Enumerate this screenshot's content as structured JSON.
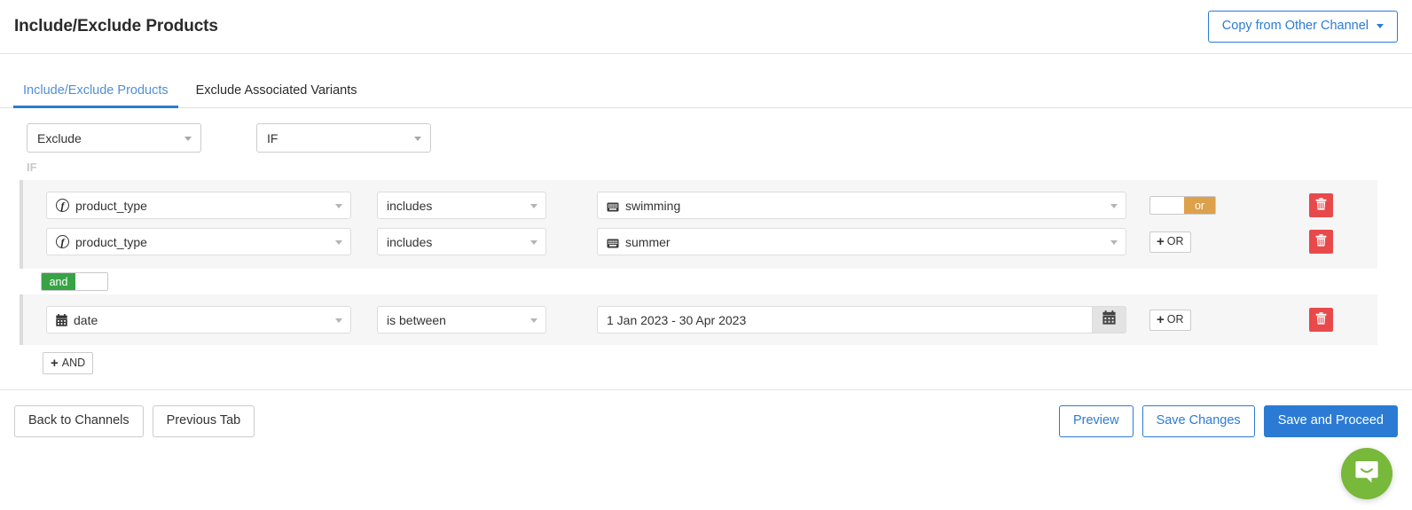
{
  "header": {
    "title": "Include/Exclude Products",
    "copy_button_label": "Copy from Other Channel"
  },
  "tabs": [
    {
      "label": "Include/Exclude Products",
      "active": true
    },
    {
      "label": "Exclude Associated Variants",
      "active": false
    }
  ],
  "top_selects": {
    "mode": "Exclude",
    "condition_keyword": "IF"
  },
  "if_label": "IF",
  "rule_groups": [
    {
      "rows": [
        {
          "field": "product_type",
          "field_icon": "function-fx-icon",
          "operator": "includes",
          "value": "swimming",
          "value_icon": "keyboard-icon",
          "logic_toggle": {
            "type": "or-toggle",
            "label": "or",
            "state": "on"
          }
        },
        {
          "field": "product_type",
          "field_icon": "function-fx-icon",
          "operator": "includes",
          "value": "summer",
          "value_icon": "keyboard-icon",
          "add_or_label": "OR"
        }
      ]
    },
    {
      "rows": [
        {
          "field": "date",
          "field_icon": "calendar-icon",
          "operator": "is between",
          "value": "1 Jan 2023 - 30 Apr 2023",
          "value_icon": "calendar-addon-icon",
          "add_or_label": "OR"
        }
      ]
    }
  ],
  "group_joiner": {
    "type": "and-toggle",
    "label": "and",
    "state": "on"
  },
  "add_and_label": "AND",
  "footer": {
    "back_label": "Back to Channels",
    "previous_label": "Previous Tab",
    "preview_label": "Preview",
    "save_changes_label": "Save Changes",
    "save_proceed_label": "Save and Proceed"
  },
  "colors": {
    "accent_blue": "#2b7bd4",
    "or_orange": "#dda14c",
    "and_green": "#37a345",
    "delete_red": "#e8494b",
    "intercom_green": "#78b83a"
  }
}
